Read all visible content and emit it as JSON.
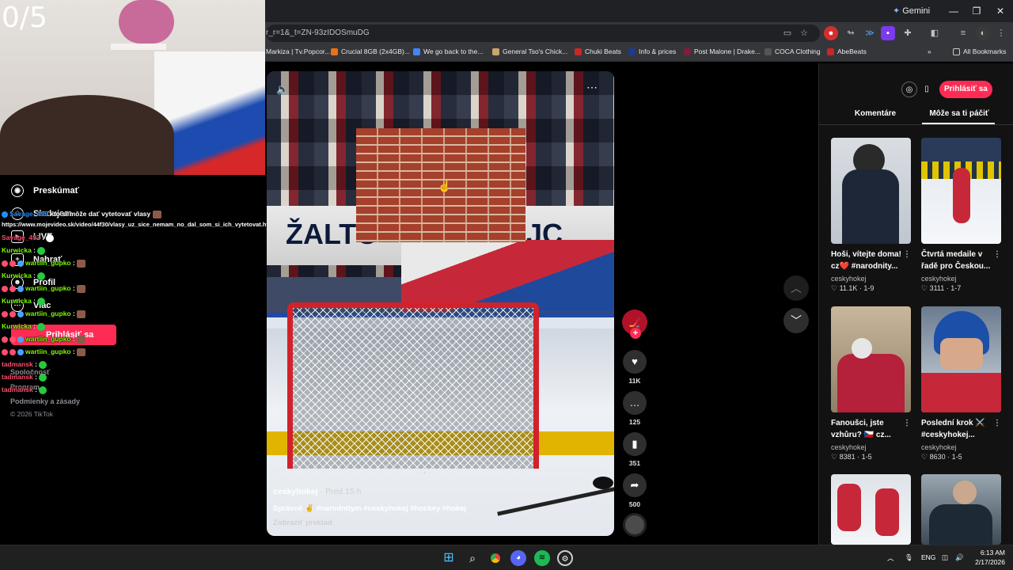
{
  "browser": {
    "gemini_label": "Gemini",
    "url": "r_r=1&_t=ZN-93zIDOSmuDG",
    "bookmarks": [
      {
        "label": "Markiza | Tv.Popcor...",
        "color": "#d33"
      },
      {
        "label": "Crucial 8GB (2x4GB)...",
        "color": "#e8711a"
      },
      {
        "label": "We go back to the...",
        "color": "#4285f4"
      },
      {
        "label": "General Tso's Chick...",
        "color": "#c9a66b"
      },
      {
        "label": "Chuki Beats",
        "color": "#c62828"
      },
      {
        "label": "Info & prices",
        "color": "#1e3a8a"
      },
      {
        "label": "Post Malone | Drake...",
        "color": "#7b1f3a"
      },
      {
        "label": "COCA Clothing",
        "color": "#333"
      },
      {
        "label": "AbeBeats",
        "color": "#c62828"
      }
    ],
    "all_bookmarks": "All Bookmarks"
  },
  "overlay": {
    "score": "0/5"
  },
  "nav": {
    "items": [
      {
        "label": "Preskúmať",
        "icon": "compass-icon"
      },
      {
        "label": "Sledujem",
        "icon": "following-icon"
      },
      {
        "label": "LIVE",
        "icon": "live-icon"
      },
      {
        "label": "Nahrať",
        "icon": "upload-icon"
      },
      {
        "label": "Profil",
        "icon": "profile-icon"
      },
      {
        "label": "Viac",
        "icon": "more-icon"
      }
    ],
    "login": "Prihlásiť sa",
    "footer": [
      "Spoločnosť",
      "Program",
      "Podmienky a zásady",
      "© 2026 TikTok"
    ]
  },
  "chat": [
    {
      "user": "Savage_492",
      "text": "kto si môže dať vytetovať vlasy",
      "cls": "u1"
    },
    {
      "user": "",
      "text": "https://www.mojevideo.sk/video/44f30/vlasy_uz_sice_nemam_no_dal_som_si_ich_vytetovat.html",
      "cls": ""
    },
    {
      "user": "Savage_492",
      "text": ":",
      "cls": "u2"
    },
    {
      "user": "Kurwicka",
      "text": ":",
      "cls": "u3"
    },
    {
      "user": "wartiin_gupko",
      "text": ":",
      "cls": "u3"
    },
    {
      "user": "Kurwicka",
      "text": ":",
      "cls": "u3"
    },
    {
      "user": "wartiin_gupko",
      "text": ":",
      "cls": "u3"
    },
    {
      "user": "Kurwicka",
      "text": ":",
      "cls": "u3"
    },
    {
      "user": "wartiin_gupko",
      "text": ":",
      "cls": "u3"
    },
    {
      "user": "Kurwicka",
      "text": ":",
      "cls": "u3"
    },
    {
      "user": "wartiin_gupko",
      "text": ":",
      "cls": "u3"
    },
    {
      "user": "wartiin_gupko",
      "text": ":",
      "cls": "u3"
    },
    {
      "user": "tadmansk",
      "text": ":",
      "cls": "u2"
    },
    {
      "user": "tadmansk",
      "text": ":",
      "cls": "u2"
    },
    {
      "user": "tadmansk",
      "text": ":",
      "cls": "u2"
    }
  ],
  "video": {
    "banner_left": "ŽALTC",
    "banner_right": "JC",
    "author": "ceskyhokej",
    "ago": "· Pred 15 h",
    "description": "Správně ✌ #narodnitym #ceskyhokej #hockey #hokej",
    "translate": "Zobraziť preklad"
  },
  "actions": {
    "likes": "11K",
    "comments": "125",
    "saves": "351",
    "shares": "500"
  },
  "right": {
    "login": "Prihlásiť sa",
    "tab_comments": "Komentáre",
    "tab_suggested": "Môže sa ti páčiť",
    "cards": [
      {
        "title": "Hoši, vítejte doma! cz❤️ #narodnity...",
        "author": "ceskyhokej",
        "stats": "♡ 11.1K · 1-9"
      },
      {
        "title": "Čtvrtá medaile v řadě pro Českou...",
        "author": "ceskyhokej",
        "stats": "♡ 3111 · 1-7"
      },
      {
        "title": "Fanoušci, jste vzhůru? 🇨🇿 cz...",
        "author": "ceskyhokej",
        "stats": "♡ 8381 · 1-5"
      },
      {
        "title": "Poslední krok ⚔️ #ceskyhokej...",
        "author": "ceskyhokej",
        "stats": "♡ 8630 · 1-5"
      }
    ]
  },
  "taskbar": {
    "lang": "ENG",
    "time": "6:13 AM",
    "date": "2/17/2026"
  }
}
